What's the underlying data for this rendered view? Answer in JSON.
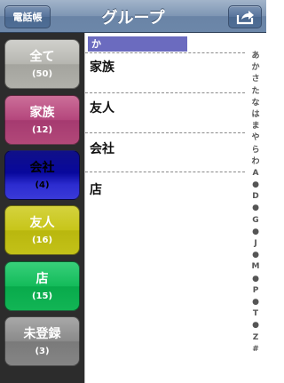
{
  "navbar": {
    "left_button": "電話帳",
    "title": "グループ",
    "right_button": "share-icon"
  },
  "groups": [
    {
      "name": "全て",
      "count": "(50)"
    },
    {
      "name": "家族",
      "count": "(12)"
    },
    {
      "name": "会社",
      "count": "(4)"
    },
    {
      "name": "友人",
      "count": "(16)"
    },
    {
      "name": "店",
      "count": "(15)"
    },
    {
      "name": "未登録",
      "count": "(3)"
    }
  ],
  "section_header": "か",
  "rows": [
    "家族",
    "友人",
    "会社",
    "店"
  ],
  "index": [
    "あ",
    "か",
    "さ",
    "た",
    "な",
    "は",
    "ま",
    "や",
    "ら",
    "わ",
    "A",
    "●",
    "D",
    "●",
    "G",
    "●",
    "J",
    "●",
    "M",
    "●",
    "P",
    "●",
    "T",
    "●",
    "Z",
    "#"
  ],
  "colors": {
    "navbar": "#7e96b4",
    "sidebar": "#2c2c2c",
    "section_header": "#6b6bbf"
  }
}
